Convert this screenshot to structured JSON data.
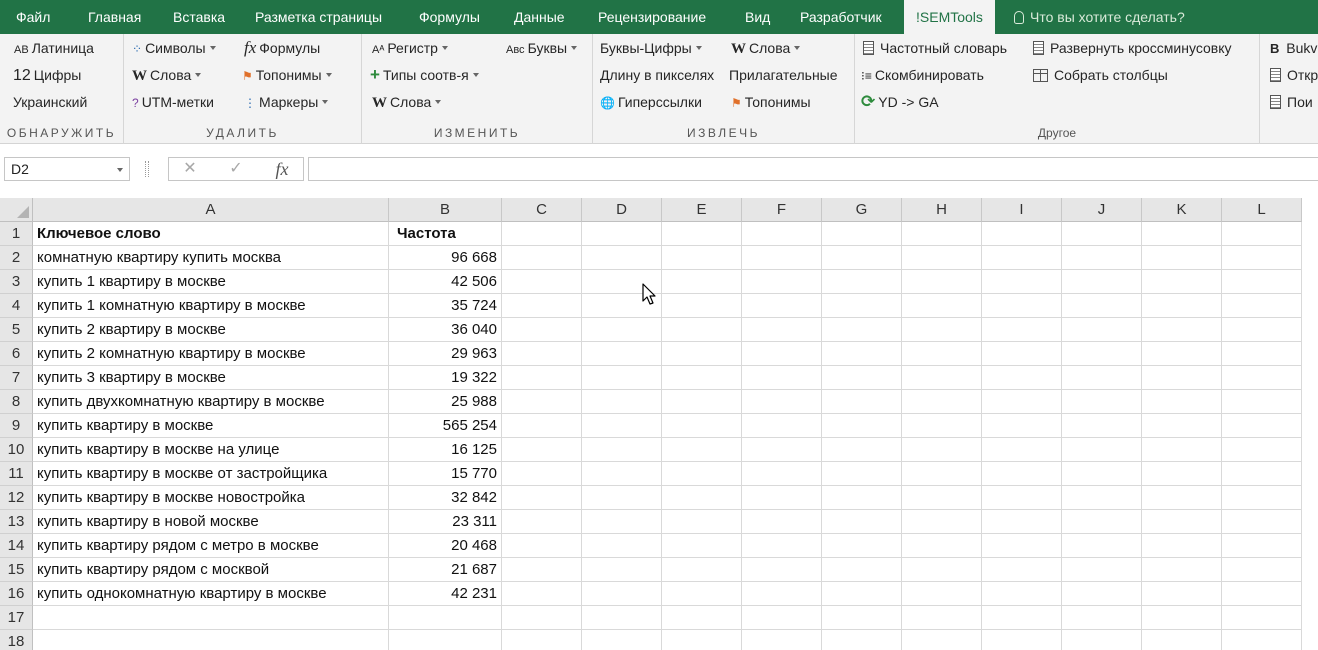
{
  "tabs": [
    {
      "label": "Файл"
    },
    {
      "label": "Главная"
    },
    {
      "label": "Вставка"
    },
    {
      "label": "Разметка страницы"
    },
    {
      "label": "Формулы"
    },
    {
      "label": "Данные"
    },
    {
      "label": "Рецензирование"
    },
    {
      "label": "Вид"
    },
    {
      "label": "Разработчик"
    },
    {
      "label": "!SEMTools"
    }
  ],
  "active_tab": "!SEMTools",
  "tell_me": "Что вы хотите сделать?",
  "ribbon": {
    "detect": {
      "label": "ОБНАРУЖИТЬ",
      "latin_icon": "AB",
      "latin": "Латиница",
      "digits_icon": "12",
      "digits": "Цифры",
      "ukrainian": "Украинский"
    },
    "remove": {
      "label": "УДАЛИТЬ",
      "symbols": "Символы",
      "words_icon": "W",
      "words": "Слова",
      "utm": "UTM-метки",
      "formulas_icon": "fx",
      "formulas": "Формулы",
      "toponyms": "Топонимы",
      "markers": "Маркеры"
    },
    "change": {
      "label": "ИЗМЕНИТЬ",
      "case": "Регистр",
      "match_types": "Типы соотв-я",
      "words_icon": "W",
      "words": "Слова",
      "letters_icon": "Авс",
      "letters": "Буквы"
    },
    "extract": {
      "label": "ИЗВЛЕЧЬ",
      "letters_digits": "Буквы-Цифры",
      "pixel_length": "Длину в пикселях",
      "hyperlinks": "Гиперссылки",
      "words_icon": "W",
      "words": "Слова",
      "adjectives": "Прилагательные",
      "toponyms": "Топонимы"
    },
    "other": {
      "label": "Другое",
      "freq_dict": "Частотный словарь",
      "combine": "Скомбинировать",
      "yd_ga": "YD -> GA",
      "expand_cross": "Развернуть кроссминусовку",
      "collect_columns": "Собрать столбцы"
    },
    "extra": {
      "bukv_icon": "B",
      "bukv": "Bukv",
      "open": "Откр",
      "search": "Пои"
    }
  },
  "name_box": "D2",
  "fx_label": "fx",
  "columns": [
    "A",
    "B",
    "C",
    "D",
    "E",
    "F",
    "G",
    "H",
    "I",
    "J",
    "K",
    "L"
  ],
  "rows": [
    {
      "num": "1",
      "a": "Ключевое слово",
      "b": "Частота"
    },
    {
      "num": "2",
      "a": "комнатную квартиру купить москва",
      "b": "96 668"
    },
    {
      "num": "3",
      "a": "купить 1 квартиру в москве",
      "b": "42 506"
    },
    {
      "num": "4",
      "a": "купить 1 комнатную квартиру в москве",
      "b": "35 724"
    },
    {
      "num": "5",
      "a": "купить 2 квартиру в москве",
      "b": "36 040"
    },
    {
      "num": "6",
      "a": "купить 2 комнатную квартиру в москве",
      "b": "29 963"
    },
    {
      "num": "7",
      "a": "купить 3 квартиру в москве",
      "b": "19 322"
    },
    {
      "num": "8",
      "a": "купить двухкомнатную квартиру в москве",
      "b": "25 988"
    },
    {
      "num": "9",
      "a": "купить квартиру в москве",
      "b": "565 254"
    },
    {
      "num": "10",
      "a": "купить квартиру в москве на улице",
      "b": "16 125"
    },
    {
      "num": "11",
      "a": "купить квартиру в москве от застройщика",
      "b": "15 770"
    },
    {
      "num": "12",
      "a": "купить квартиру в москве новостройка",
      "b": "32 842"
    },
    {
      "num": "13",
      "a": "купить квартиру в новой москве",
      "b": "23 311"
    },
    {
      "num": "14",
      "a": "купить квартиру рядом с метро в москве",
      "b": "20 468"
    },
    {
      "num": "15",
      "a": "купить квартиру рядом с москвой",
      "b": "21 687"
    },
    {
      "num": "16",
      "a": "купить однокомнатную квартиру в москве",
      "b": "42 231"
    },
    {
      "num": "17",
      "a": "",
      "b": ""
    },
    {
      "num": "18",
      "a": "",
      "b": ""
    }
  ],
  "colors": {
    "accent": "#217346",
    "ribbon_bg": "#f3f3f3",
    "header_bg": "#e6e6e6",
    "gridline": "#d9d9d9"
  }
}
